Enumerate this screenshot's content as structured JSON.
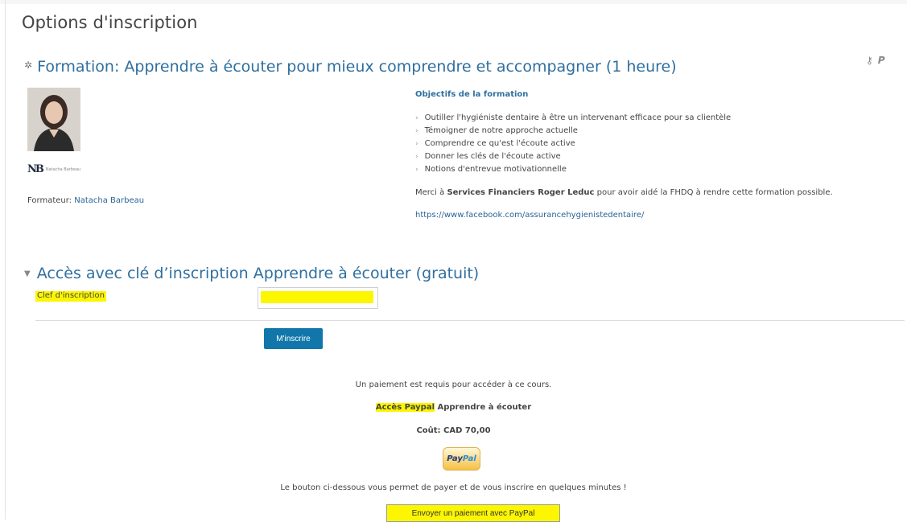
{
  "page": {
    "title": "Options d'inscription"
  },
  "course": {
    "title": "Formation: Apprendre à écouter pour mieux comprendre et accompagner (1 heure)",
    "teacher_prefix": "Formateur: ",
    "teacher_name": "Natacha Barbeau",
    "logo_initials": "NB",
    "logo_name": "Natacha Barbeau"
  },
  "objectives": {
    "title": "Objectifs de la formation",
    "items": [
      "Outiller l'hygiéniste dentaire à être un intervenant efficace pour sa clientèle",
      "Témoigner de notre approche actuelle",
      "Comprendre ce qu'est l'écoute active",
      "Donner les clés de l'écoute active",
      "Notions d'entrevue motivationnelle"
    ],
    "thanks_prefix": "Merci à ",
    "thanks_sponsor": "Services Financiers Roger Leduc",
    "thanks_suffix": " pour avoir aidé la FHDQ à rendre cette formation possible.",
    "facebook_url": "https://www.facebook.com/assurancehygienistedentaire/"
  },
  "key_section": {
    "title": "Accès avec clé d’inscription Apprendre à écouter (gratuit)",
    "key_label": "Clef d'inscription",
    "key_value": "",
    "enrol_button": "M'inscrire"
  },
  "paypal_section": {
    "required_text": "Un paiement est requis pour accéder à ce cours.",
    "access_highlight": "Accès Paypal",
    "access_rest": " Apprendre à écouter",
    "cost_text": "Coût: CAD 70,00",
    "logo_part1": "Pay",
    "logo_part2": "Pal",
    "note": "Le bouton ci-dessous vous permet de payer et de vous inscrire en quelques minutes !",
    "pay_button": "Envoyer un paiement avec PayPal"
  },
  "icons": {
    "gear": "gear-icon",
    "admin_key": "key-icon",
    "admin_paypal": "paypal-icon",
    "caret": "caret-down-icon",
    "bullet": "bullet-icon"
  },
  "colors": {
    "link": "#2f6f9f",
    "button": "#1177aa",
    "highlight": "#fcf600"
  }
}
